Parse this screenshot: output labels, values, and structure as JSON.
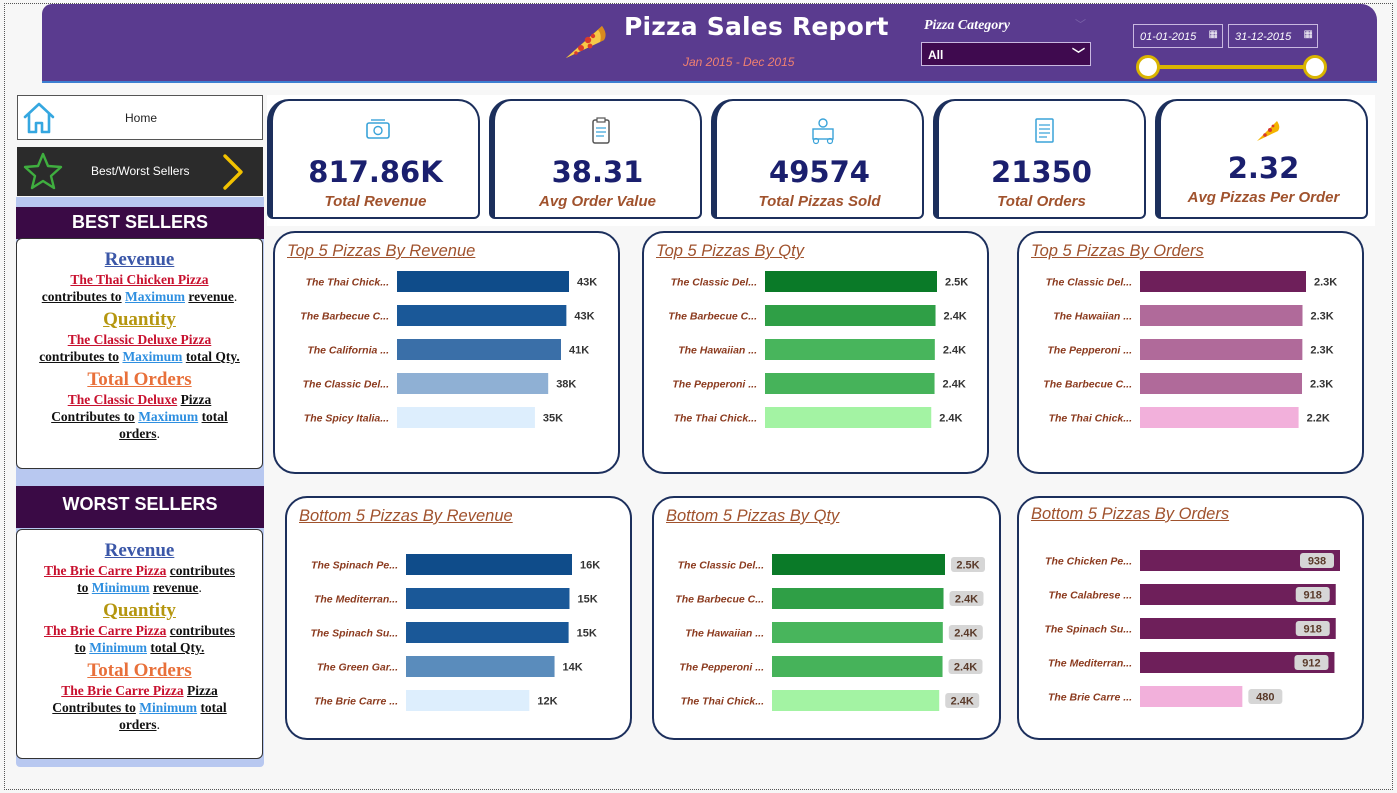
{
  "header": {
    "title": "Pizza Sales Report",
    "subtitle": "Jan 2015 - Dec 2015",
    "category_label": "Pizza Category",
    "category_value": "All",
    "date_start": "01-01-2015",
    "date_end": "31-12-2015",
    "accent_color": "#5a3b8f"
  },
  "nav": {
    "home_label": "Home",
    "bw_label": "Best/Worst Sellers"
  },
  "best": {
    "heading": "BEST SELLERS",
    "rev_h": "Revenue",
    "rev_pizza": "The Thai Chicken Pizza",
    "rev_t1": "contributes to",
    "rev_max": "Maximum",
    "rev_t2": "revenue",
    "qty_h": "Quantity",
    "qty_pizza": "The Classic Deluxe Pizza",
    "qty_t1": "contributes to",
    "qty_max": "Maximum",
    "qty_t2": "total Qty.",
    "ord_h": "Total Orders",
    "ord_pizza": "The Classic Deluxe",
    "ord_pz": "Pizza",
    "ord_t1": "Contributes to",
    "ord_max": "Maximum",
    "ord_t2": "total",
    "ord_t3": "orders"
  },
  "worst": {
    "heading": "WORST SELLERS",
    "rev_h": "Revenue",
    "rev_pizza": "The Brie Carre Pizza",
    "rev_t1": "contributes",
    "rev_t1b": "to",
    "rev_min": "Minimum",
    "rev_t2": "revenue",
    "qty_h": "Quantity",
    "qty_pizza": "The Brie Carre Pizza",
    "qty_t1": "contributes",
    "qty_t1b": "to",
    "qty_min": "Minimum",
    "qty_t2": "total Qty.",
    "ord_h": "Total Orders",
    "ord_pizza": "The Brie Carre Pizza",
    "ord_pz": "Pizza",
    "ord_t1": "Contributes to",
    "ord_min": "Minimum",
    "ord_t2": "total",
    "ord_t3": "orders"
  },
  "kpis": [
    {
      "value": "817.86K",
      "label": "Total Revenue",
      "icon": "money-icon"
    },
    {
      "value": "38.31",
      "label": "Avg Order Value",
      "icon": "clipboard-icon"
    },
    {
      "value": "49574",
      "label": "Total Pizzas Sold",
      "icon": "delivery-icon"
    },
    {
      "value": "21350",
      "label": "Total Orders",
      "icon": "order-list-icon"
    },
    {
      "value": "2.32",
      "label": "Avg Pizzas Per Order",
      "icon": "pizza-slice-icon"
    }
  ],
  "chart_data": [
    {
      "type": "bar",
      "title": "Top 5 Pizzas By Revenue",
      "categories": [
        "The Thai Chick...",
        "The Barbecue C...",
        "The California ...",
        "The Classic Del...",
        "The Spicy Italia..."
      ],
      "values": [
        43434,
        42768,
        41410,
        38180,
        34831
      ],
      "data_labels": [
        "43K",
        "43K",
        "41K",
        "38K",
        "35K"
      ],
      "colors": [
        "#0f4c8a",
        "#1a5898",
        "#3a6fa8",
        "#8fb0d4",
        "#ddeefd"
      ],
      "labeled_boxes": false
    },
    {
      "type": "bar",
      "title": "Top 5 Pizzas By Qty",
      "categories": [
        "The Classic Del...",
        "The Barbecue C...",
        "The Hawaiian ...",
        "The Pepperoni ...",
        "The Thai Chick..."
      ],
      "values": [
        2453,
        2432,
        2422,
        2418,
        2371
      ],
      "data_labels": [
        "2.5K",
        "2.4K",
        "2.4K",
        "2.4K",
        "2.4K"
      ],
      "colors": [
        "#0a7a28",
        "#2f9f46",
        "#48b55c",
        "#46b35a",
        "#a3f3a3"
      ],
      "labeled_boxes": false
    },
    {
      "type": "bar",
      "title": "Top 5 Pizzas By Orders",
      "categories": [
        "The Classic Del...",
        "The Hawaiian ...",
        "The Pepperoni ...",
        "The Barbecue C...",
        "The Thai Chick..."
      ],
      "values": [
        2329,
        2280,
        2278,
        2273,
        2225
      ],
      "data_labels": [
        "2.3K",
        "2.3K",
        "2.3K",
        "2.3K",
        "2.2K"
      ],
      "colors": [
        "#6e1f5a",
        "#b06a9a",
        "#b06a9a",
        "#b06a9a",
        "#f2b0db"
      ],
      "labeled_boxes": false
    },
    {
      "type": "bar",
      "title": "Bottom 5 Pizzas By Revenue",
      "categories": [
        "The Spinach Pe...",
        "The Mediterran...",
        "The Spinach Su...",
        "The Green Gar...",
        "The Brie Carre ..."
      ],
      "values": [
        15596,
        15360,
        15277,
        13956,
        11588
      ],
      "data_labels": [
        "16K",
        "15K",
        "15K",
        "14K",
        "12K"
      ],
      "colors": [
        "#0f4c8a",
        "#1a5898",
        "#1a5898",
        "#5a8cbc",
        "#ddeefd"
      ],
      "labeled_boxes": false
    },
    {
      "type": "bar",
      "title": "Bottom 5 Pizzas By Qty",
      "categories": [
        "The Classic Del...",
        "The Barbecue C...",
        "The Hawaiian ...",
        "The Pepperoni ...",
        "The Thai Chick..."
      ],
      "values": [
        2453,
        2432,
        2422,
        2418,
        2371
      ],
      "data_labels": [
        "2.5K",
        "2.4K",
        "2.4K",
        "2.4K",
        "2.4K"
      ],
      "colors": [
        "#0a7a28",
        "#2f9f46",
        "#48b55c",
        "#46b35a",
        "#a3f3a3"
      ],
      "labeled_boxes": true
    },
    {
      "type": "bar",
      "title": "Bottom 5 Pizzas By Orders",
      "categories": [
        "The Chicken Pe...",
        "The Calabrese ...",
        "The Spinach Su...",
        "The Mediterran...",
        "The Brie Carre ..."
      ],
      "values": [
        938,
        918,
        918,
        912,
        480
      ],
      "data_labels": [
        "938",
        "918",
        "918",
        "912",
        "480"
      ],
      "colors": [
        "#6e1f5a",
        "#6e1f5a",
        "#6e1f5a",
        "#6e1f5a",
        "#f2b0db"
      ],
      "labeled_boxes": true
    }
  ]
}
